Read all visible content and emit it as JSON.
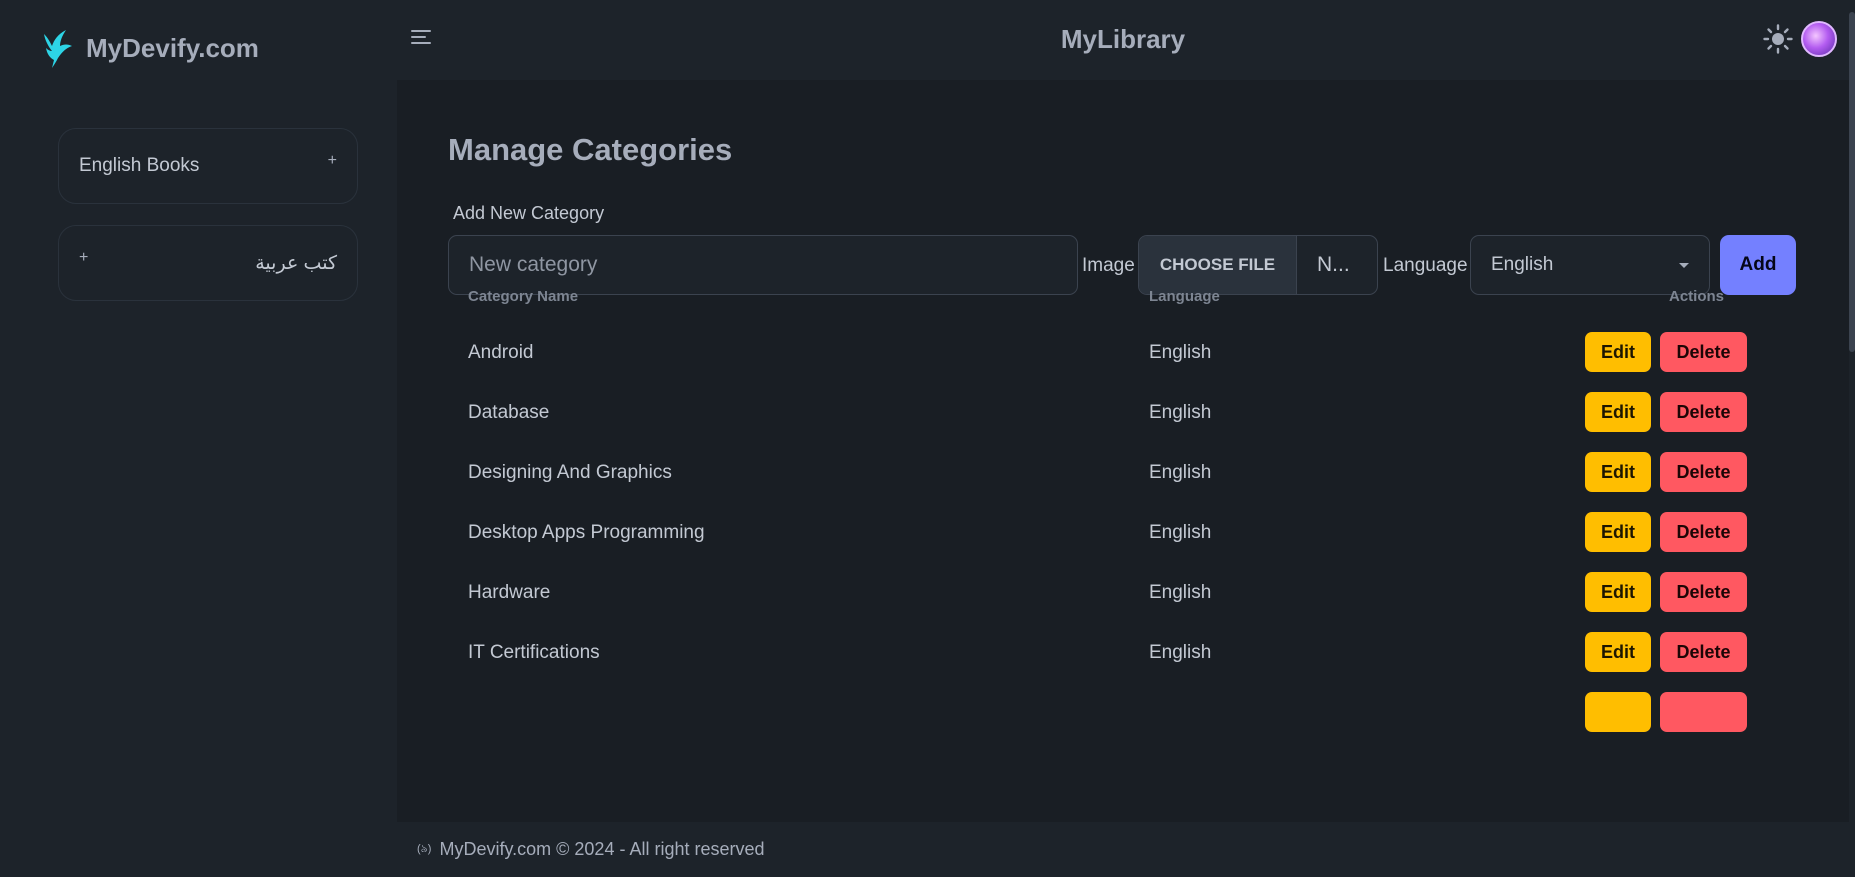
{
  "brand": {
    "name": "MyDevify.com",
    "logo_icon": "bird-logo-icon",
    "logo_color": "#2dd4e6"
  },
  "sidebar": {
    "items": [
      {
        "label": "English Books",
        "toggle": "+"
      },
      {
        "label": "كتب عربية",
        "toggle": "+"
      }
    ]
  },
  "header": {
    "title": "MyLibrary",
    "menu_icon": "hamburger-menu-icon",
    "theme_icon": "sun-icon",
    "avatar_icon": "user-avatar"
  },
  "main": {
    "page_title": "Manage Categories",
    "form": {
      "section_label": "Add New Category",
      "name_placeholder": "New category",
      "image_label": "Image",
      "file_button": "CHOOSE FILE",
      "file_status": "N...",
      "language_label": "Language",
      "language_selected": "English",
      "add_button": "Add"
    },
    "table": {
      "headers": {
        "name": "Category Name",
        "language": "Language",
        "actions": "Actions"
      },
      "rows": [
        {
          "name": "Android",
          "language": "English"
        },
        {
          "name": "Database",
          "language": "English"
        },
        {
          "name": "Designing And Graphics",
          "language": "English"
        },
        {
          "name": "Desktop Apps Programming",
          "language": "English"
        },
        {
          "name": "Hardware",
          "language": "English"
        },
        {
          "name": "IT Certifications",
          "language": "English"
        }
      ],
      "edit_label": "Edit",
      "delete_label": "Delete"
    }
  },
  "footer": {
    "icon_text": "(৯)",
    "text": "MyDevify.com © 2024 - All right reserved"
  },
  "colors": {
    "accent": "#7480ff",
    "edit": "#ffbe00",
    "delete": "#ff5861",
    "background": "#1d232a"
  }
}
